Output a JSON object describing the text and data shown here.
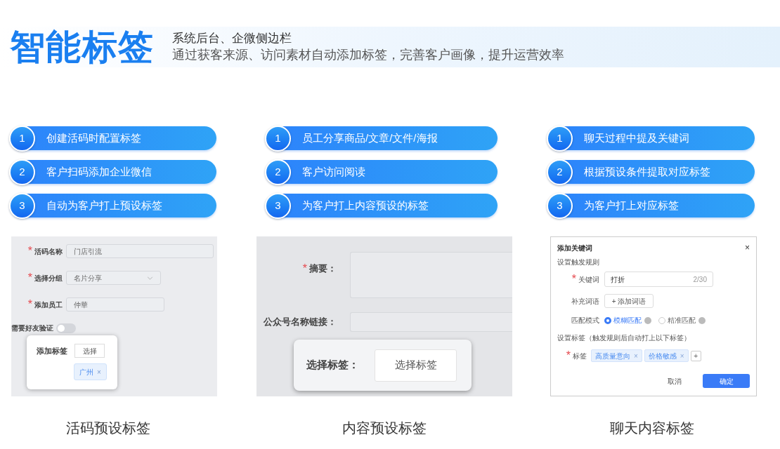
{
  "header": {
    "title": "智能标签",
    "subtitle": "系统后台、企微侧边栏",
    "description": "通过获客来源、访问素材自动添加标签，完善客户画像，提升运营效率"
  },
  "columns": [
    {
      "steps": [
        {
          "number": "1",
          "text": "创建活码时配置标签"
        },
        {
          "number": "2",
          "text": "客户扫码添加企业微信"
        },
        {
          "number": "3",
          "text": "自动为客户打上预设标签"
        }
      ],
      "screen": {
        "kind": "form",
        "fields": [
          {
            "label": "活码名称",
            "required_mark": "*",
            "value": "门店引流",
            "kind": "input"
          },
          {
            "label": "选择分组",
            "required_mark": "*",
            "value": "名片分享",
            "kind": "select"
          },
          {
            "label": "添加员工",
            "required_mark": "*",
            "value": "仲華",
            "kind": "input"
          }
        ],
        "switch": {
          "label": "需要好友验证",
          "on": false
        },
        "popup": {
          "label": "添加标签",
          "button": "选择",
          "tag": "广州",
          "tag_close": "×"
        }
      },
      "caption": "活码预设标签"
    },
    {
      "steps": [
        {
          "number": "1",
          "text": "员工分享商品/文章/文件/海报"
        },
        {
          "number": "2",
          "text": "客户访问阅读"
        },
        {
          "number": "3",
          "text": "为客户打上内容预设的标签"
        }
      ],
      "screen": {
        "kind": "content",
        "fields": [
          {
            "label": "摘要：",
            "required_mark": "*",
            "kind": "textarea"
          },
          {
            "label": "公众号名称链接：",
            "kind": "input"
          }
        ],
        "popup": {
          "label": "选择标签：",
          "button": "选择标签"
        }
      },
      "caption": "内容预设标签"
    },
    {
      "steps": [
        {
          "number": "1",
          "text": "聊天过程中提及关键词"
        },
        {
          "number": "2",
          "text": "根据预设条件提取对应标签"
        },
        {
          "number": "3",
          "text": "为客户打上对应标签"
        }
      ],
      "screen": {
        "kind": "dialog",
        "title": "添加关键词",
        "close": "×",
        "section_1": "设置触发规则",
        "keyword_required_mark": "*",
        "keyword_label": "关键词",
        "keyword_value": "打折",
        "keyword_count": "2/30",
        "extra_label": "补充词语",
        "extra_button": "+ 添加词语",
        "match_label": "匹配模式",
        "options": [
          {
            "label": "模糊匹配",
            "selected": true
          },
          {
            "label": "精准匹配",
            "selected": false
          }
        ],
        "section_2": "设置标签（触发规则后自动打上以下标签）",
        "tags_required_mark": "*",
        "tags_label": "标签",
        "tags": [
          {
            "label": "高质量意向",
            "close": "×"
          },
          {
            "label": "价格敏感",
            "close": "×"
          }
        ],
        "add_tag": "+",
        "cancel": "取消",
        "confirm": "确定"
      },
      "caption": "聊天内容标签"
    }
  ]
}
